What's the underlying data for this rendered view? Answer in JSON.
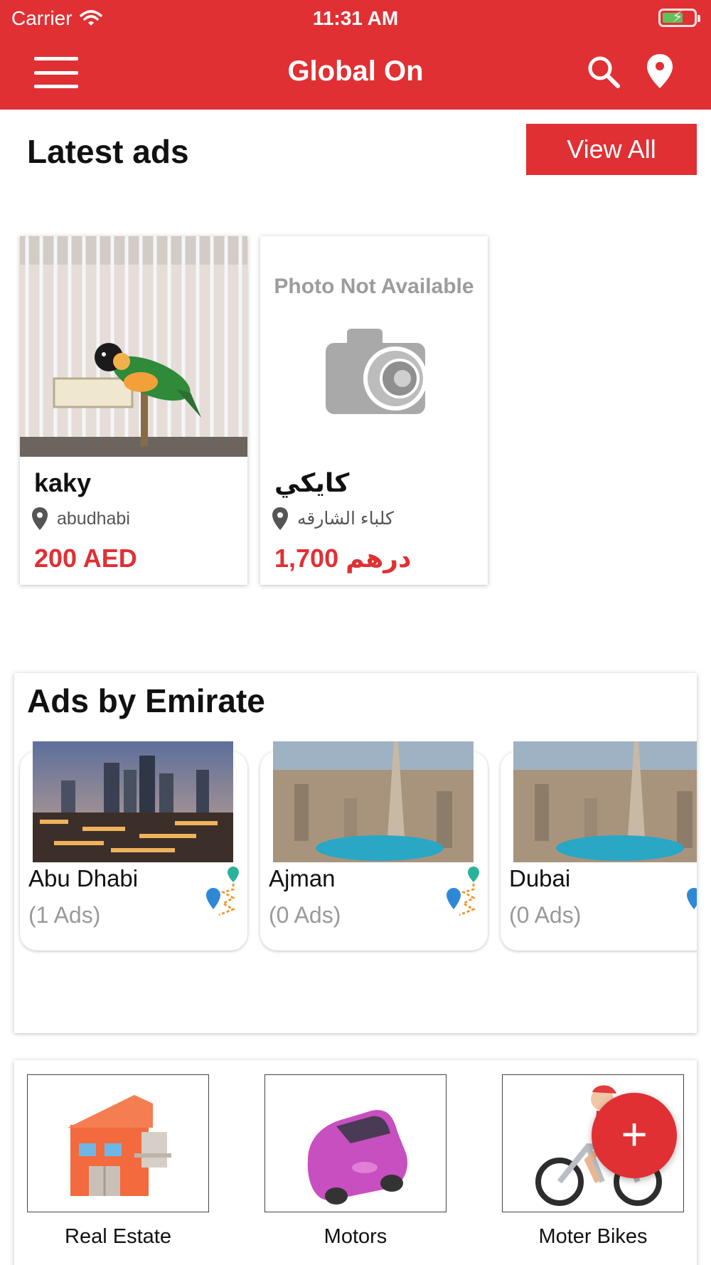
{
  "status_bar": {
    "carrier": "Carrier",
    "time": "11:31 AM"
  },
  "header": {
    "title": "Global On",
    "menu_icon": "hamburger-menu-icon",
    "search_icon": "search-icon",
    "location_icon": "map-pin-icon"
  },
  "colors": {
    "brand": "#e03034",
    "muted": "#999999"
  },
  "latest": {
    "title": "Latest ads",
    "view_all": "View All",
    "ads": [
      {
        "name": "kaky",
        "location": "abudhabi",
        "price": "200 AED",
        "image": "parrot-photo"
      },
      {
        "name": "كايكي",
        "location": "كلباء الشارقه",
        "price": "1,700 درهم",
        "image": "photo-not-available",
        "placeholder_text": "Photo Not Available"
      }
    ]
  },
  "emirates": {
    "title": "Ads by Emirate",
    "items": [
      {
        "name": "Abu Dhabi",
        "count": "(1 Ads)"
      },
      {
        "name": "Ajman",
        "count": "(0 Ads)"
      },
      {
        "name": "Dubai",
        "count": "(0 Ads)"
      }
    ]
  },
  "categories": [
    {
      "label": "Real Estate",
      "icon": "building-icon"
    },
    {
      "label": "Motors",
      "icon": "car-icon"
    },
    {
      "label": "Moter Bikes",
      "icon": "cyclist-icon"
    }
  ],
  "fab": {
    "label": "+"
  }
}
